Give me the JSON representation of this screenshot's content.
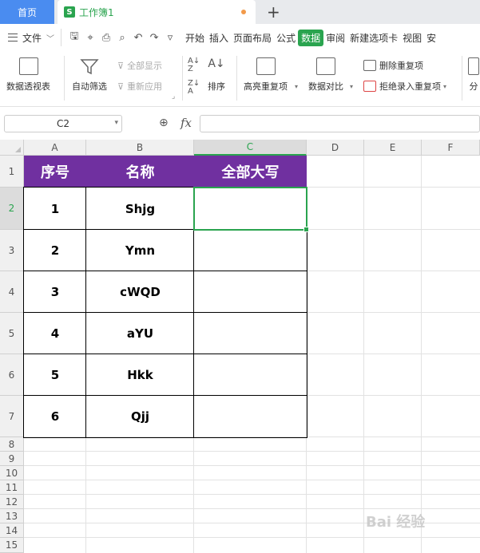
{
  "tabs": {
    "home": "首页",
    "doc_icon": "S",
    "doc_title": "工作簿1",
    "new_tab": "+"
  },
  "menu": {
    "file": "文件",
    "items": [
      "开始",
      "插入",
      "页面布局",
      "公式",
      "数据",
      "审阅",
      "新建选项卡",
      "视图",
      "安"
    ],
    "active": "数据"
  },
  "ribbon": {
    "pivot": "数据透视表",
    "autofilter": "自动筛选",
    "show_all": "全部显示",
    "reapply": "重新应用",
    "sort": "排序",
    "highlight_dup": "高亮重复项",
    "compare": "数据对比",
    "delete_dup": "删除重复项",
    "reject_dup": "拒绝录入重复项",
    "split": "分"
  },
  "formula_bar": {
    "name_box": "C2",
    "fx": "fx",
    "formula": ""
  },
  "columns": [
    "A",
    "B",
    "C",
    "D",
    "E",
    "F"
  ],
  "rows": [
    "1",
    "2",
    "3",
    "4",
    "5",
    "6",
    "7",
    "8",
    "9",
    "10",
    "11",
    "12",
    "13",
    "14",
    "15"
  ],
  "selected_cell": "C2",
  "table": {
    "headers": [
      "序号",
      "名称",
      "全部大写"
    ],
    "rows": [
      [
        "1",
        "Shjg",
        ""
      ],
      [
        "2",
        "Ymn",
        ""
      ],
      [
        "3",
        "cWQD",
        ""
      ],
      [
        "4",
        "aYU",
        ""
      ],
      [
        "5",
        "Hkk",
        ""
      ],
      [
        "6",
        "Qjj",
        ""
      ]
    ]
  },
  "colors": {
    "header_bg": "#7030a0",
    "accent_green": "#2aa44f",
    "home_tab": "#4a8cf0"
  },
  "watermark": "Bai 经验"
}
